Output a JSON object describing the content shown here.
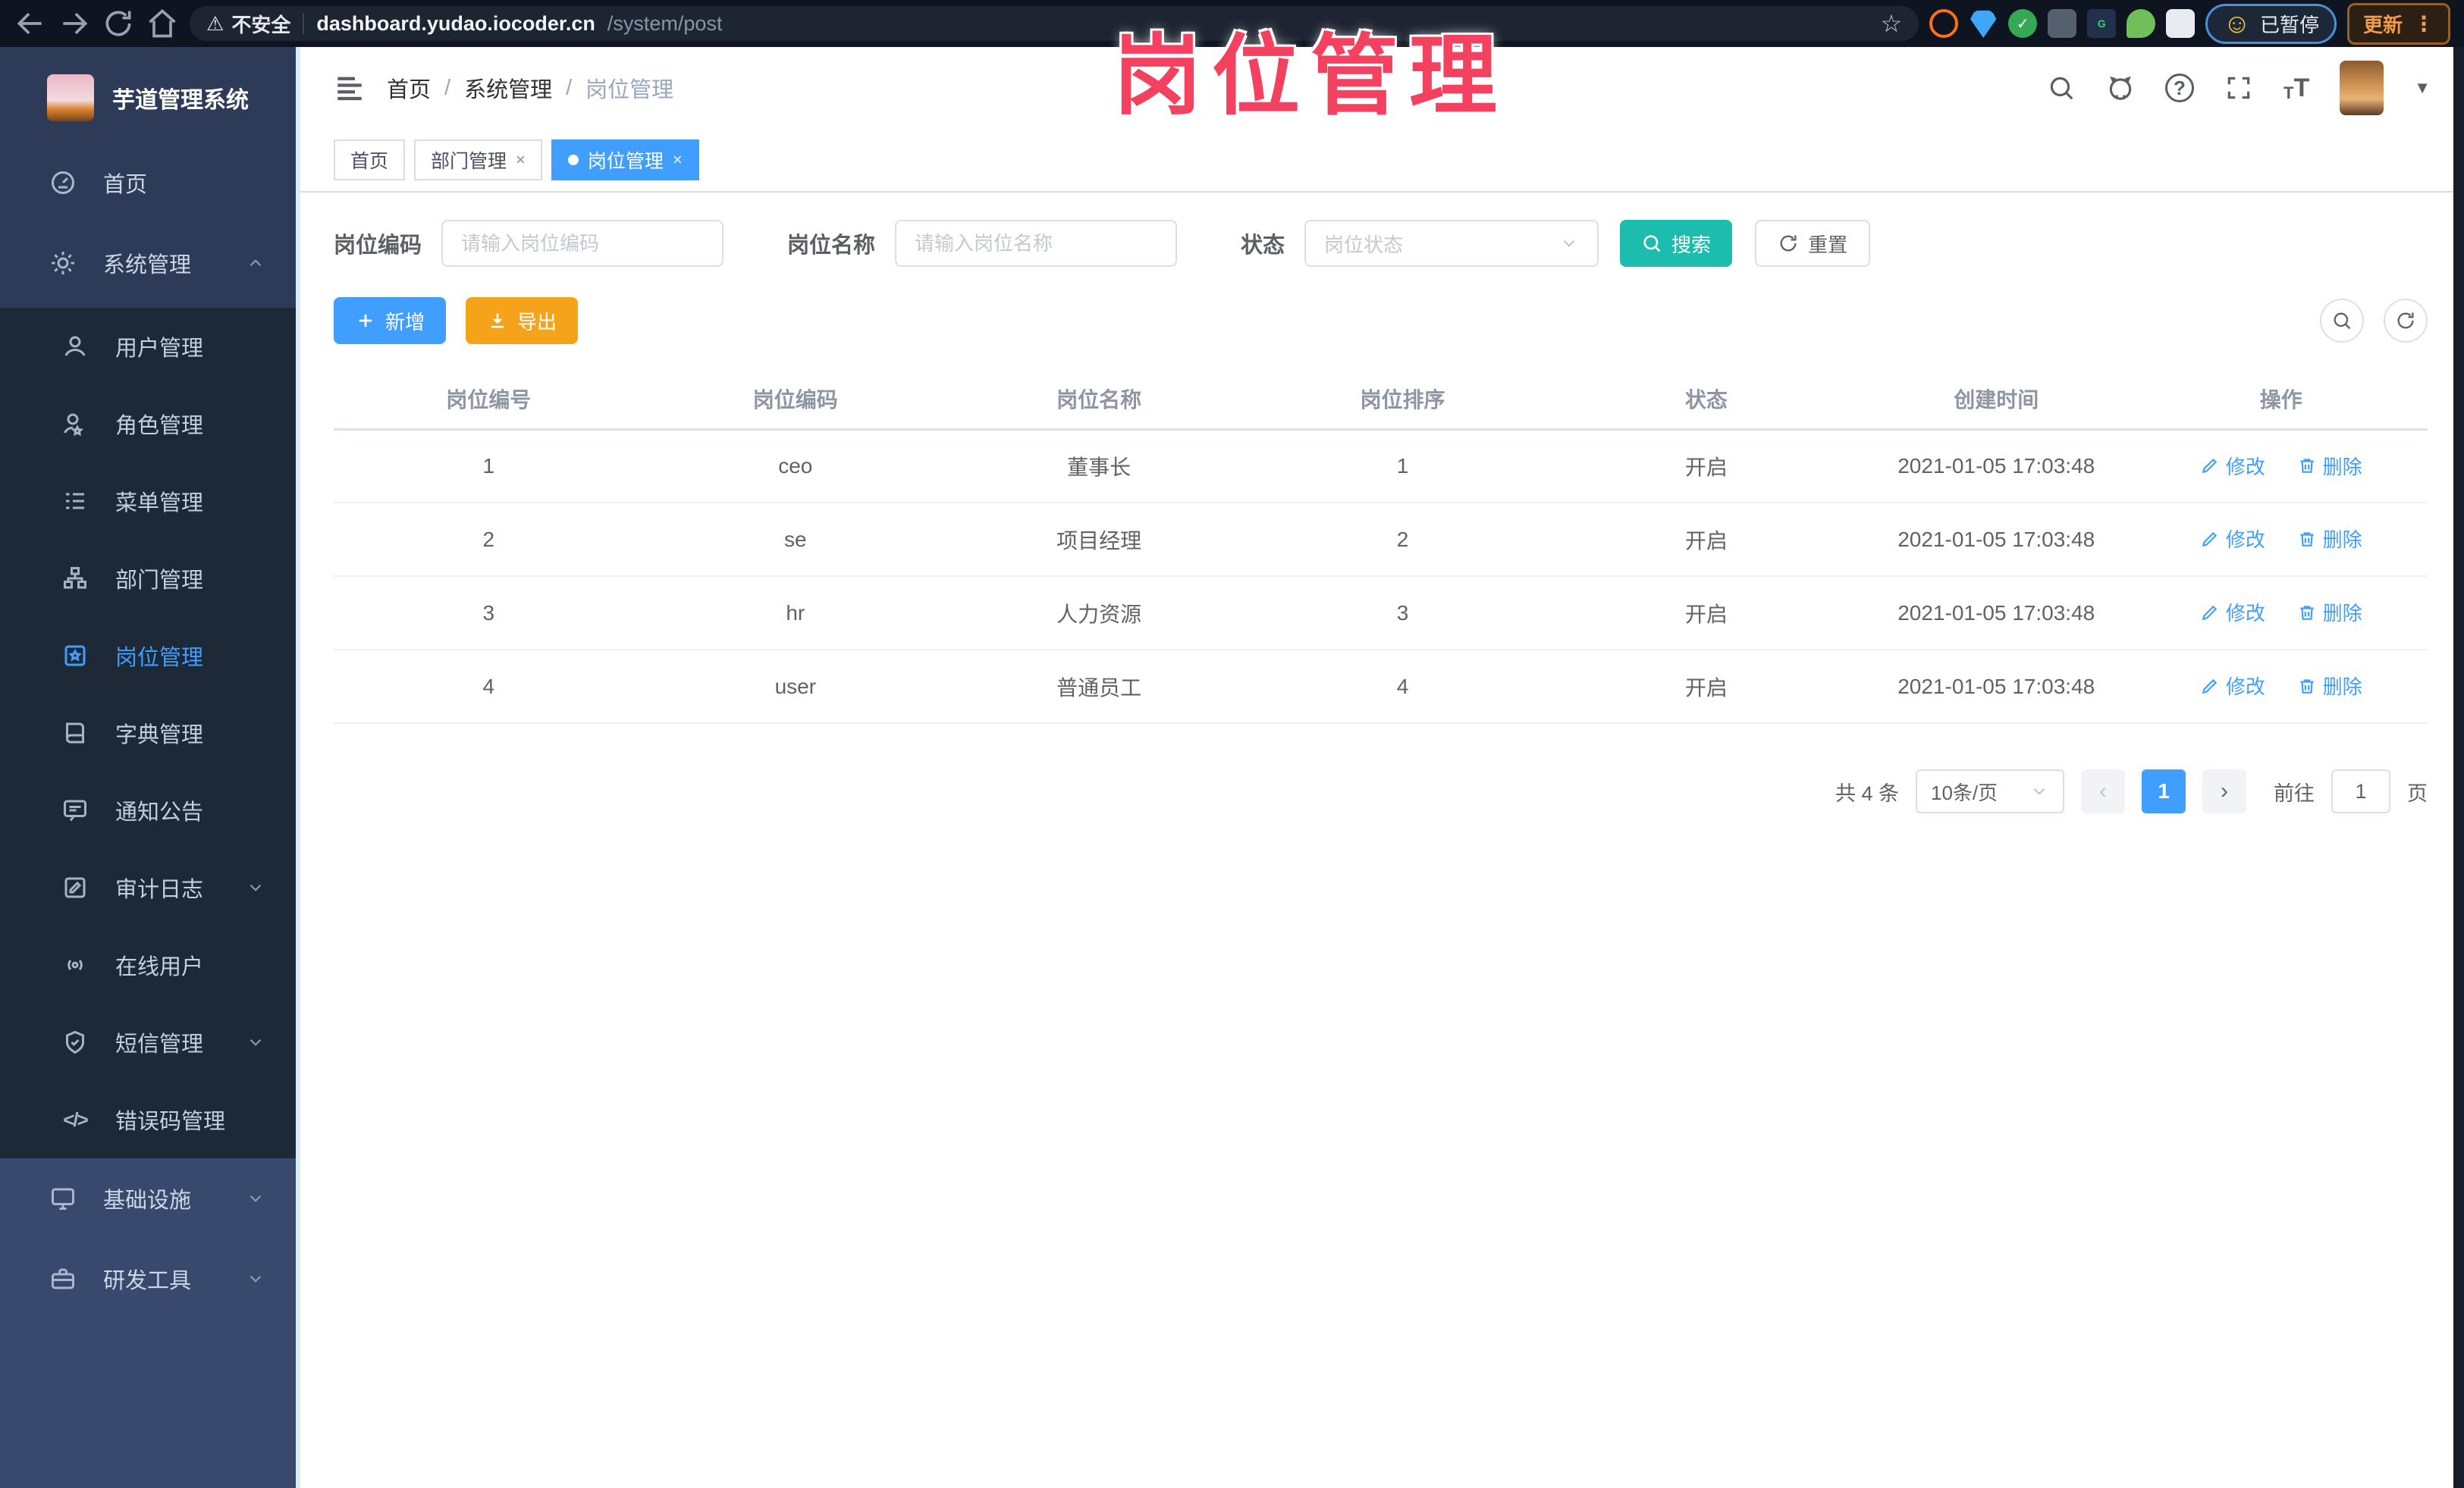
{
  "browser": {
    "security_label": "不安全",
    "url_host": "dashboard.yudao.iocoder.cn",
    "url_path": "/system/post",
    "paused_label": "已暂停",
    "update_label": "更新"
  },
  "watermark": "岗位管理",
  "sidebar": {
    "title": "芋道管理系统",
    "items": {
      "home": "首页",
      "system": "系统管理",
      "user": "用户管理",
      "role": "角色管理",
      "menu": "菜单管理",
      "dept": "部门管理",
      "post": "岗位管理",
      "dict": "字典管理",
      "notice": "通知公告",
      "audit": "审计日志",
      "online": "在线用户",
      "sms": "短信管理",
      "errcode": "错误码管理",
      "infra": "基础设施",
      "devtool": "研发工具"
    }
  },
  "header": {
    "breadcrumb": [
      "首页",
      "系统管理",
      "岗位管理"
    ],
    "separator": "/"
  },
  "tabs": [
    {
      "label": "首页"
    },
    {
      "label": "部门管理",
      "close": "×"
    },
    {
      "label": "岗位管理",
      "close": "×"
    }
  ],
  "filters": {
    "code_label": "岗位编码",
    "code_placeholder": "请输入岗位编码",
    "name_label": "岗位名称",
    "name_placeholder": "请输入岗位名称",
    "status_label": "状态",
    "status_placeholder": "岗位状态",
    "search_label": "搜索",
    "reset_label": "重置"
  },
  "toolbar": {
    "add_label": "新增",
    "export_label": "导出"
  },
  "table": {
    "headers": [
      "岗位编号",
      "岗位编码",
      "岗位名称",
      "岗位排序",
      "状态",
      "创建时间",
      "操作"
    ],
    "rows": [
      [
        "1",
        "ceo",
        "董事长",
        "1",
        "开启",
        "2021-01-05 17:03:48"
      ],
      [
        "2",
        "se",
        "项目经理",
        "2",
        "开启",
        "2021-01-05 17:03:48"
      ],
      [
        "3",
        "hr",
        "人力资源",
        "3",
        "开启",
        "2021-01-05 17:03:48"
      ],
      [
        "4",
        "user",
        "普通员工",
        "4",
        "开启",
        "2021-01-05 17:03:48"
      ]
    ],
    "edit_label": "修改",
    "delete_label": "删除"
  },
  "pagination": {
    "total_text": "共 4 条",
    "page_size": "10条/页",
    "prev": "‹",
    "current_page": "1",
    "next": "›",
    "goto_label": "前往",
    "goto_value": "1",
    "page_unit": "页"
  },
  "colors": {
    "primary": "#409EFF",
    "search_teal": "#1cbcae",
    "export_orange": "#f5a31a",
    "watermark_pink": "#f4415f",
    "sidebar_dark": "#2e3b58",
    "submenu_dark": "#1d2936"
  }
}
